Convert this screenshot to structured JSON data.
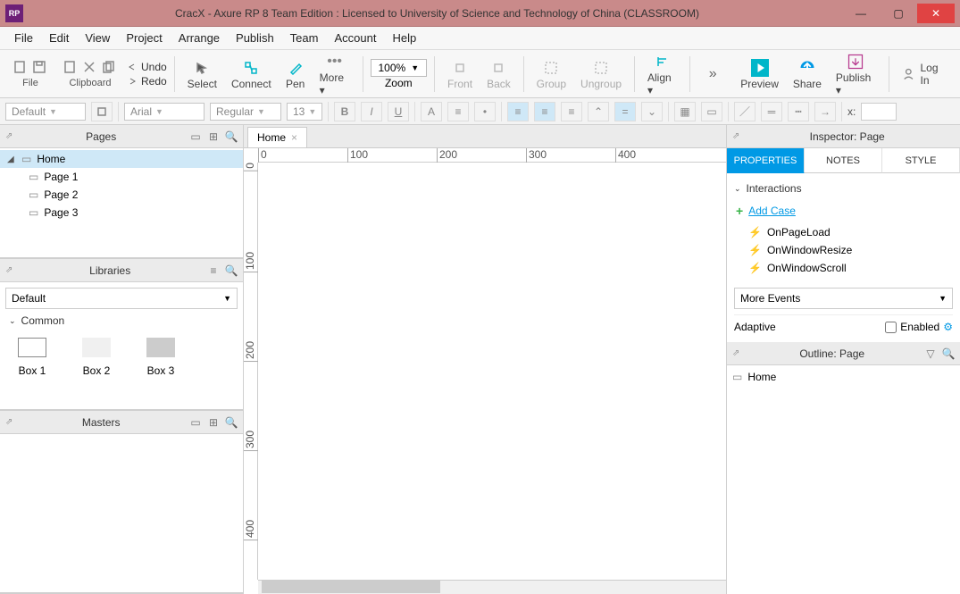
{
  "titlebar": {
    "title": "CracX - Axure RP 8 Team Edition : Licensed to University of Science and Technology of China (CLASSROOM)"
  },
  "menu": [
    "File",
    "Edit",
    "View",
    "Project",
    "Arrange",
    "Publish",
    "Team",
    "Account",
    "Help"
  ],
  "ribbon": {
    "file": "File",
    "clipboard": "Clipboard",
    "undo": "Undo",
    "redo": "Redo",
    "select": "Select",
    "connect": "Connect",
    "pen": "Pen",
    "more": "More ▾",
    "zoom_val": "100%",
    "zoom": "Zoom",
    "front": "Front",
    "back": "Back",
    "group": "Group",
    "ungroup": "Ungroup",
    "align": "Align ▾",
    "preview": "Preview",
    "share": "Share",
    "publish": "Publish ▾",
    "login": "Log In"
  },
  "propbar": {
    "style": "Default",
    "font": "Arial",
    "weight": "Regular",
    "size": "13",
    "xlabel": "x:"
  },
  "pages": {
    "title": "Pages",
    "root": "Home",
    "children": [
      "Page 1",
      "Page 2",
      "Page 3"
    ]
  },
  "libraries": {
    "title": "Libraries",
    "dd": "Default",
    "section": "Common",
    "shapes": [
      "Box 1",
      "Box 2",
      "Box 3"
    ]
  },
  "masters": {
    "title": "Masters"
  },
  "canvas": {
    "tab": "Home",
    "hticks": [
      0,
      100,
      200,
      300,
      400
    ],
    "vticks": [
      0,
      100,
      200,
      300,
      400
    ]
  },
  "inspector": {
    "title": "Inspector: Page",
    "tabs": [
      "PROPERTIES",
      "NOTES",
      "STYLE"
    ],
    "section": "Interactions",
    "addcase": "Add Case",
    "events": [
      "OnPageLoad",
      "OnWindowResize",
      "OnWindowScroll"
    ],
    "more": "More Events",
    "adaptive": "Adaptive",
    "enabled": "Enabled"
  },
  "outline": {
    "title": "Outline: Page",
    "item": "Home"
  }
}
